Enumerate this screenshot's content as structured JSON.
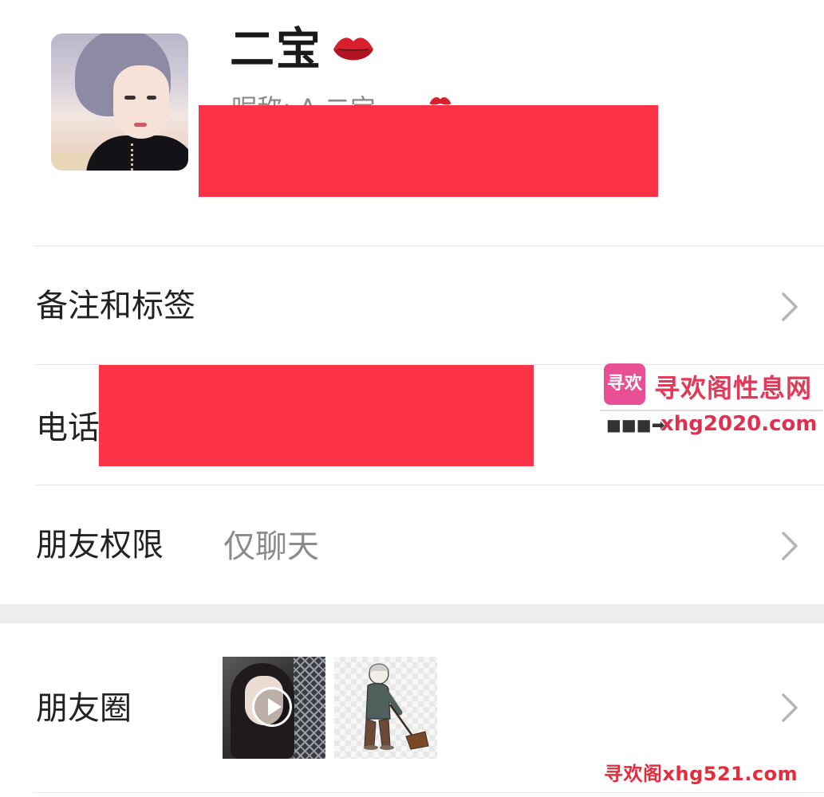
{
  "profile": {
    "name": "二宝",
    "nickname_visible": "昵称: A 二宝",
    "avatar_alt": "profile-photo"
  },
  "rows": {
    "remark": {
      "label": "备注和标签"
    },
    "phone": {
      "label": "电话"
    },
    "permission": {
      "label": "朋友权限",
      "value": "仅聊天"
    },
    "moments": {
      "label": "朋友圈"
    }
  },
  "watermark": {
    "logo_text": "寻欢",
    "site_name": "寻欢阁性息网",
    "arrow": "■■■➡",
    "url": "xhg2020.com",
    "bottom": "寻欢阁xhg521.com"
  },
  "colors": {
    "redaction": "#fc3347",
    "lips": "#d8202c",
    "chevron": "#b5b5b5",
    "watermark_red": "#e0304f"
  },
  "icons": {
    "name_badge": "lips-icon",
    "row_arrow": "chevron-right-icon",
    "video": "play-icon"
  }
}
